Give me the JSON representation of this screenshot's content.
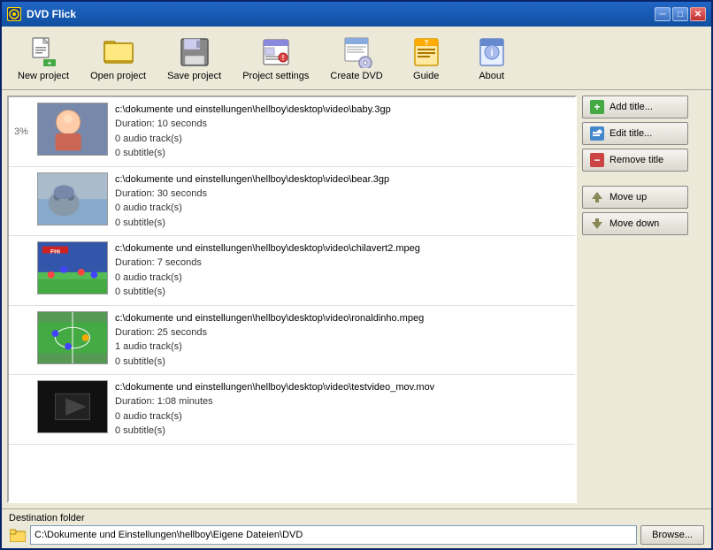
{
  "window": {
    "title": "DVD Flick",
    "title_icon": "🎬"
  },
  "title_bar_buttons": {
    "minimize": "─",
    "maximize": "□",
    "close": "✕"
  },
  "toolbar": {
    "items": [
      {
        "id": "new-project",
        "label": "New project",
        "icon": "new-project-icon"
      },
      {
        "id": "open-project",
        "label": "Open project",
        "icon": "open-project-icon"
      },
      {
        "id": "save-project",
        "label": "Save project",
        "icon": "save-project-icon"
      },
      {
        "id": "project-settings",
        "label": "Project settings",
        "icon": "project-settings-icon"
      },
      {
        "id": "create-dvd",
        "label": "Create DVD",
        "icon": "create-dvd-icon"
      },
      {
        "id": "guide",
        "label": "Guide",
        "icon": "guide-icon"
      },
      {
        "id": "about",
        "label": "About",
        "icon": "about-icon"
      }
    ]
  },
  "video_list": {
    "items": [
      {
        "path": "c:\\dokumente und einstellungen\\hellboy\\desktop\\video\\baby.3gp",
        "duration": "Duration: 10 seconds",
        "audio": "0 audio track(s)",
        "subtitles": "0 subtitle(s)",
        "thumb_class": "thumb-baby",
        "row": "3%"
      },
      {
        "path": "c:\\dokumente und einstellungen\\hellboy\\desktop\\video\\bear.3gp",
        "duration": "Duration: 30 seconds",
        "audio": "0 audio track(s)",
        "subtitles": "0 subtitle(s)",
        "thumb_class": "thumb-bear",
        "row": ""
      },
      {
        "path": "c:\\dokumente und einstellungen\\hellboy\\desktop\\video\\chilavert2.mpeg",
        "duration": "Duration: 7 seconds",
        "audio": "0 audio track(s)",
        "subtitles": "0 subtitle(s)",
        "thumb_class": "thumb-chilavert",
        "row": ""
      },
      {
        "path": "c:\\dokumente und einstellungen\\hellboy\\desktop\\video\\ronaldinho.mpeg",
        "duration": "Duration: 25 seconds",
        "audio": "1 audio track(s)",
        "subtitles": "0 subtitle(s)",
        "thumb_class": "thumb-ronaldo",
        "row": ""
      },
      {
        "path": "c:\\dokumente und einstellungen\\hellboy\\desktop\\video\\testvideo_mov.mov",
        "duration": "Duration: 1:08 minutes",
        "audio": "0 audio track(s)",
        "subtitles": "0 subtitle(s)",
        "thumb_class": "thumb-test",
        "row": ""
      }
    ]
  },
  "action_buttons": {
    "add_title": "Add title...",
    "edit_title": "Edit title...",
    "remove_title": "Remove title",
    "move_up": "Move up",
    "move_down": "Move down"
  },
  "bottom": {
    "dest_label": "Destination folder",
    "dest_path": "C:\\Dokumente und Einstellungen\\hellboy\\Eigene Dateien\\DVD",
    "browse_label": "Browse..."
  }
}
